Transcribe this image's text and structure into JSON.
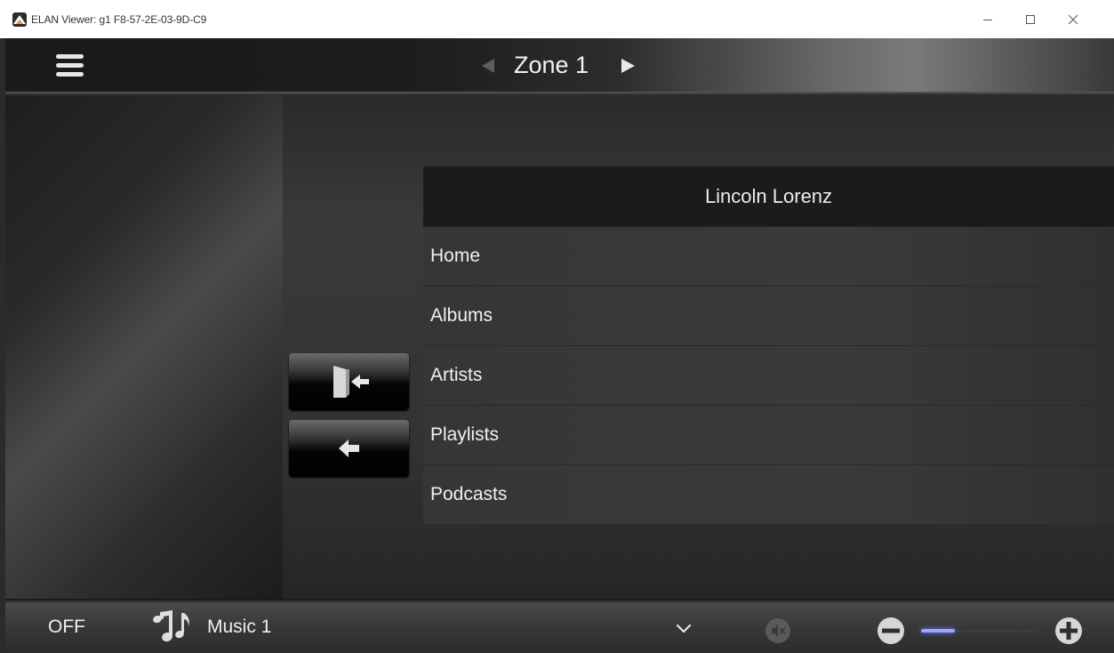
{
  "window": {
    "title": "ELAN Viewer: g1 F8-57-2E-03-9D-C9"
  },
  "header": {
    "zone_title": "Zone 1"
  },
  "list": {
    "header": "Lincoln Lorenz",
    "items": [
      "Home",
      "Albums",
      "Artists",
      "Playlists",
      "Podcasts"
    ]
  },
  "footer": {
    "power_label": "OFF",
    "source_label": "Music 1",
    "volume_level_percent": 29
  },
  "icons": {
    "menu": "hamburger-icon",
    "zone_prev": "triangle-left-icon",
    "zone_next": "triangle-right-icon",
    "exit": "door-exit-icon",
    "back": "arrow-left-icon",
    "source": "music-notes-icon",
    "source_select": "chevron-down-icon",
    "mute": "mute-icon",
    "volume_down": "minus-circle-icon",
    "volume_up": "plus-circle-icon"
  },
  "colors": {
    "volume_accent": "#9fa6ff",
    "list_header_bg": "#1b1b1b",
    "text": "#f0f0f0"
  }
}
